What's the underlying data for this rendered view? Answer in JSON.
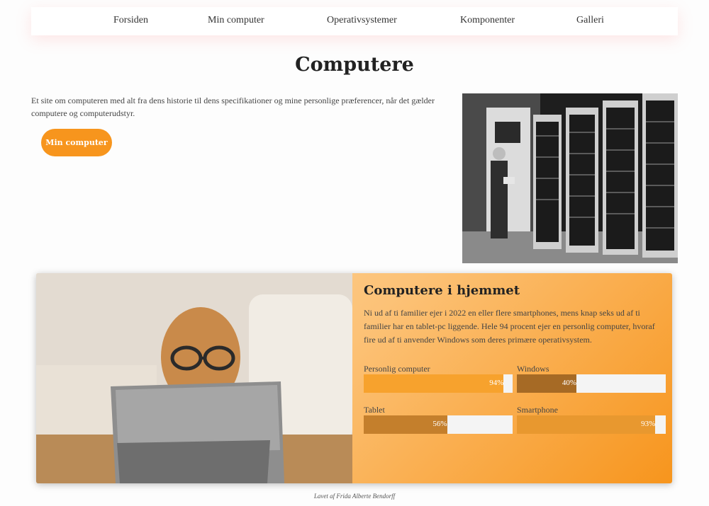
{
  "nav": {
    "items": [
      {
        "label": "Forsiden"
      },
      {
        "label": "Min computer"
      },
      {
        "label": "Operativsystemer"
      },
      {
        "label": "Komponenter"
      },
      {
        "label": "Galleri"
      }
    ]
  },
  "hero": {
    "title": "Computere",
    "intro": "Et site om computeren med alt fra dens historie til dens specifikationer og mine personlige præferencer, når det gælder computere og computerudstyr.",
    "button_label": "Min computer"
  },
  "card": {
    "title": "Computere i hjemmet",
    "text": "Ni ud af ti familier ejer i 2022 en eller flere smartphones, mens knap seks ud af ti familier har en tablet-pc liggende. Hele 94 procent ejer en personlig computer, hvoraf fire ud af ti anvender Windows som deres primære operativsystem.",
    "stats": [
      {
        "label": "Personlig computer",
        "percent": 94,
        "display": "94%",
        "color": "#f7a22d"
      },
      {
        "label": "Windows",
        "percent": 40,
        "display": "40%",
        "color": "#a66a25"
      },
      {
        "label": "Tablet",
        "percent": 56,
        "display": "56%",
        "color": "#c47f2c"
      },
      {
        "label": "Smartphone",
        "percent": 93,
        "display": "93%",
        "color": "#e8982f"
      }
    ]
  },
  "footer": {
    "text": "Lavet af Frida Alberte Bendorff"
  },
  "colors": {
    "accent": "#f7951d",
    "card_gradient_start": "#fdd7a0",
    "card_gradient_end": "#f7951d"
  }
}
